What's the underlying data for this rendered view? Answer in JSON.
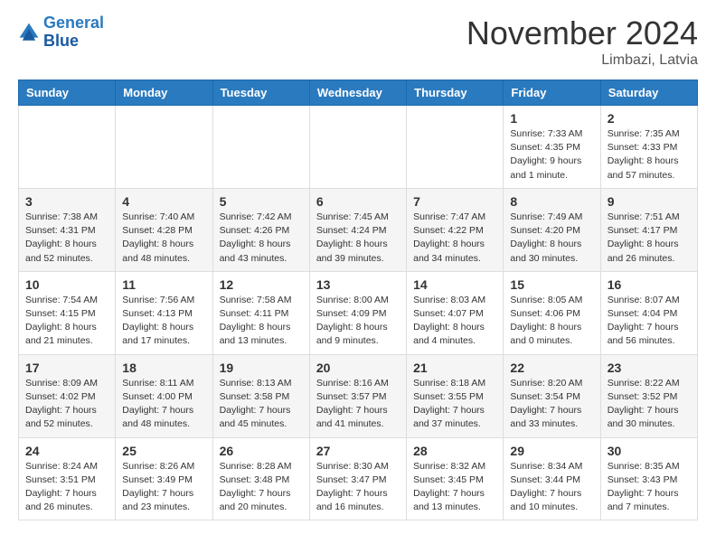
{
  "header": {
    "logo_line1": "General",
    "logo_line2": "Blue",
    "month": "November 2024",
    "location": "Limbazi, Latvia"
  },
  "days_of_week": [
    "Sunday",
    "Monday",
    "Tuesday",
    "Wednesday",
    "Thursday",
    "Friday",
    "Saturday"
  ],
  "weeks": [
    [
      {
        "num": "",
        "info": ""
      },
      {
        "num": "",
        "info": ""
      },
      {
        "num": "",
        "info": ""
      },
      {
        "num": "",
        "info": ""
      },
      {
        "num": "",
        "info": ""
      },
      {
        "num": "1",
        "info": "Sunrise: 7:33 AM\nSunset: 4:35 PM\nDaylight: 9 hours\nand 1 minute."
      },
      {
        "num": "2",
        "info": "Sunrise: 7:35 AM\nSunset: 4:33 PM\nDaylight: 8 hours\nand 57 minutes."
      }
    ],
    [
      {
        "num": "3",
        "info": "Sunrise: 7:38 AM\nSunset: 4:31 PM\nDaylight: 8 hours\nand 52 minutes."
      },
      {
        "num": "4",
        "info": "Sunrise: 7:40 AM\nSunset: 4:28 PM\nDaylight: 8 hours\nand 48 minutes."
      },
      {
        "num": "5",
        "info": "Sunrise: 7:42 AM\nSunset: 4:26 PM\nDaylight: 8 hours\nand 43 minutes."
      },
      {
        "num": "6",
        "info": "Sunrise: 7:45 AM\nSunset: 4:24 PM\nDaylight: 8 hours\nand 39 minutes."
      },
      {
        "num": "7",
        "info": "Sunrise: 7:47 AM\nSunset: 4:22 PM\nDaylight: 8 hours\nand 34 minutes."
      },
      {
        "num": "8",
        "info": "Sunrise: 7:49 AM\nSunset: 4:20 PM\nDaylight: 8 hours\nand 30 minutes."
      },
      {
        "num": "9",
        "info": "Sunrise: 7:51 AM\nSunset: 4:17 PM\nDaylight: 8 hours\nand 26 minutes."
      }
    ],
    [
      {
        "num": "10",
        "info": "Sunrise: 7:54 AM\nSunset: 4:15 PM\nDaylight: 8 hours\nand 21 minutes."
      },
      {
        "num": "11",
        "info": "Sunrise: 7:56 AM\nSunset: 4:13 PM\nDaylight: 8 hours\nand 17 minutes."
      },
      {
        "num": "12",
        "info": "Sunrise: 7:58 AM\nSunset: 4:11 PM\nDaylight: 8 hours\nand 13 minutes."
      },
      {
        "num": "13",
        "info": "Sunrise: 8:00 AM\nSunset: 4:09 PM\nDaylight: 8 hours\nand 9 minutes."
      },
      {
        "num": "14",
        "info": "Sunrise: 8:03 AM\nSunset: 4:07 PM\nDaylight: 8 hours\nand 4 minutes."
      },
      {
        "num": "15",
        "info": "Sunrise: 8:05 AM\nSunset: 4:06 PM\nDaylight: 8 hours\nand 0 minutes."
      },
      {
        "num": "16",
        "info": "Sunrise: 8:07 AM\nSunset: 4:04 PM\nDaylight: 7 hours\nand 56 minutes."
      }
    ],
    [
      {
        "num": "17",
        "info": "Sunrise: 8:09 AM\nSunset: 4:02 PM\nDaylight: 7 hours\nand 52 minutes."
      },
      {
        "num": "18",
        "info": "Sunrise: 8:11 AM\nSunset: 4:00 PM\nDaylight: 7 hours\nand 48 minutes."
      },
      {
        "num": "19",
        "info": "Sunrise: 8:13 AM\nSunset: 3:58 PM\nDaylight: 7 hours\nand 45 minutes."
      },
      {
        "num": "20",
        "info": "Sunrise: 8:16 AM\nSunset: 3:57 PM\nDaylight: 7 hours\nand 41 minutes."
      },
      {
        "num": "21",
        "info": "Sunrise: 8:18 AM\nSunset: 3:55 PM\nDaylight: 7 hours\nand 37 minutes."
      },
      {
        "num": "22",
        "info": "Sunrise: 8:20 AM\nSunset: 3:54 PM\nDaylight: 7 hours\nand 33 minutes."
      },
      {
        "num": "23",
        "info": "Sunrise: 8:22 AM\nSunset: 3:52 PM\nDaylight: 7 hours\nand 30 minutes."
      }
    ],
    [
      {
        "num": "24",
        "info": "Sunrise: 8:24 AM\nSunset: 3:51 PM\nDaylight: 7 hours\nand 26 minutes."
      },
      {
        "num": "25",
        "info": "Sunrise: 8:26 AM\nSunset: 3:49 PM\nDaylight: 7 hours\nand 23 minutes."
      },
      {
        "num": "26",
        "info": "Sunrise: 8:28 AM\nSunset: 3:48 PM\nDaylight: 7 hours\nand 20 minutes."
      },
      {
        "num": "27",
        "info": "Sunrise: 8:30 AM\nSunset: 3:47 PM\nDaylight: 7 hours\nand 16 minutes."
      },
      {
        "num": "28",
        "info": "Sunrise: 8:32 AM\nSunset: 3:45 PM\nDaylight: 7 hours\nand 13 minutes."
      },
      {
        "num": "29",
        "info": "Sunrise: 8:34 AM\nSunset: 3:44 PM\nDaylight: 7 hours\nand 10 minutes."
      },
      {
        "num": "30",
        "info": "Sunrise: 8:35 AM\nSunset: 3:43 PM\nDaylight: 7 hours\nand 7 minutes."
      }
    ]
  ]
}
